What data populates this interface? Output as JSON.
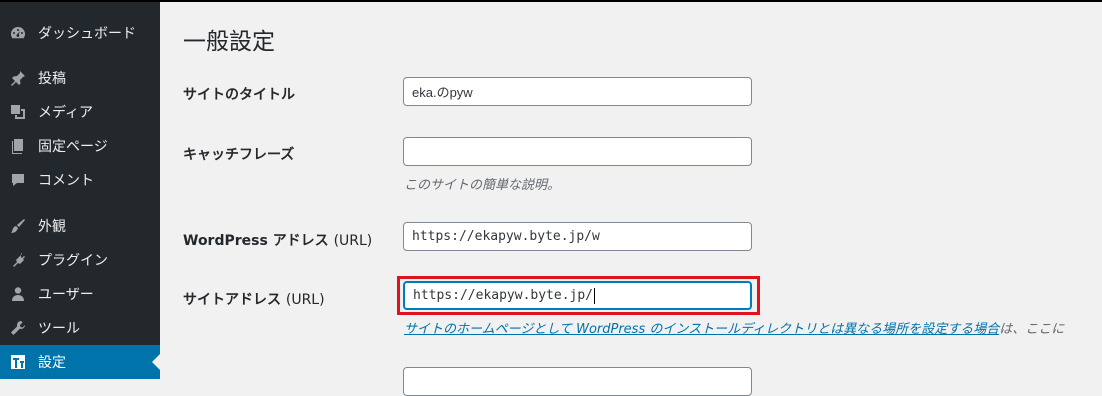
{
  "sidebar": {
    "items": [
      {
        "label": "ダッシュボード",
        "icon": "dashboard-icon"
      },
      {
        "label": "投稿",
        "icon": "pin-icon"
      },
      {
        "label": "メディア",
        "icon": "media-icon"
      },
      {
        "label": "固定ページ",
        "icon": "pages-icon"
      },
      {
        "label": "コメント",
        "icon": "comment-icon"
      },
      {
        "label": "外観",
        "icon": "brush-icon"
      },
      {
        "label": "プラグイン",
        "icon": "plugin-icon"
      },
      {
        "label": "ユーザー",
        "icon": "user-icon"
      },
      {
        "label": "ツール",
        "icon": "wrench-icon"
      },
      {
        "label": "設定",
        "icon": "settings-icon",
        "active": true
      }
    ],
    "active_color": "#0073aa",
    "bg_color": "#23282d"
  },
  "page": {
    "title": "一般設定"
  },
  "form": {
    "site_title": {
      "label": "サイトのタイトル",
      "value": "eka.のpyw"
    },
    "tagline": {
      "label": "キャッチフレーズ",
      "value": "",
      "description": "このサイトの簡単な説明。"
    },
    "wp_address": {
      "label_jp": "WordPress アドレス",
      "label_url": "(URL)",
      "value": "https://ekapyw.byte.jp/w"
    },
    "site_address": {
      "label_jp": "サイトアドレス",
      "label_url": "(URL)",
      "value": "https://ekapyw.byte.jp/",
      "link_text": "サイトのホームページとして WordPress のインストールディレクトリとは異なる場所を設定する場合",
      "after_link": "は、ここに"
    }
  },
  "annotation": {
    "highlight_color": "#e0141e"
  }
}
